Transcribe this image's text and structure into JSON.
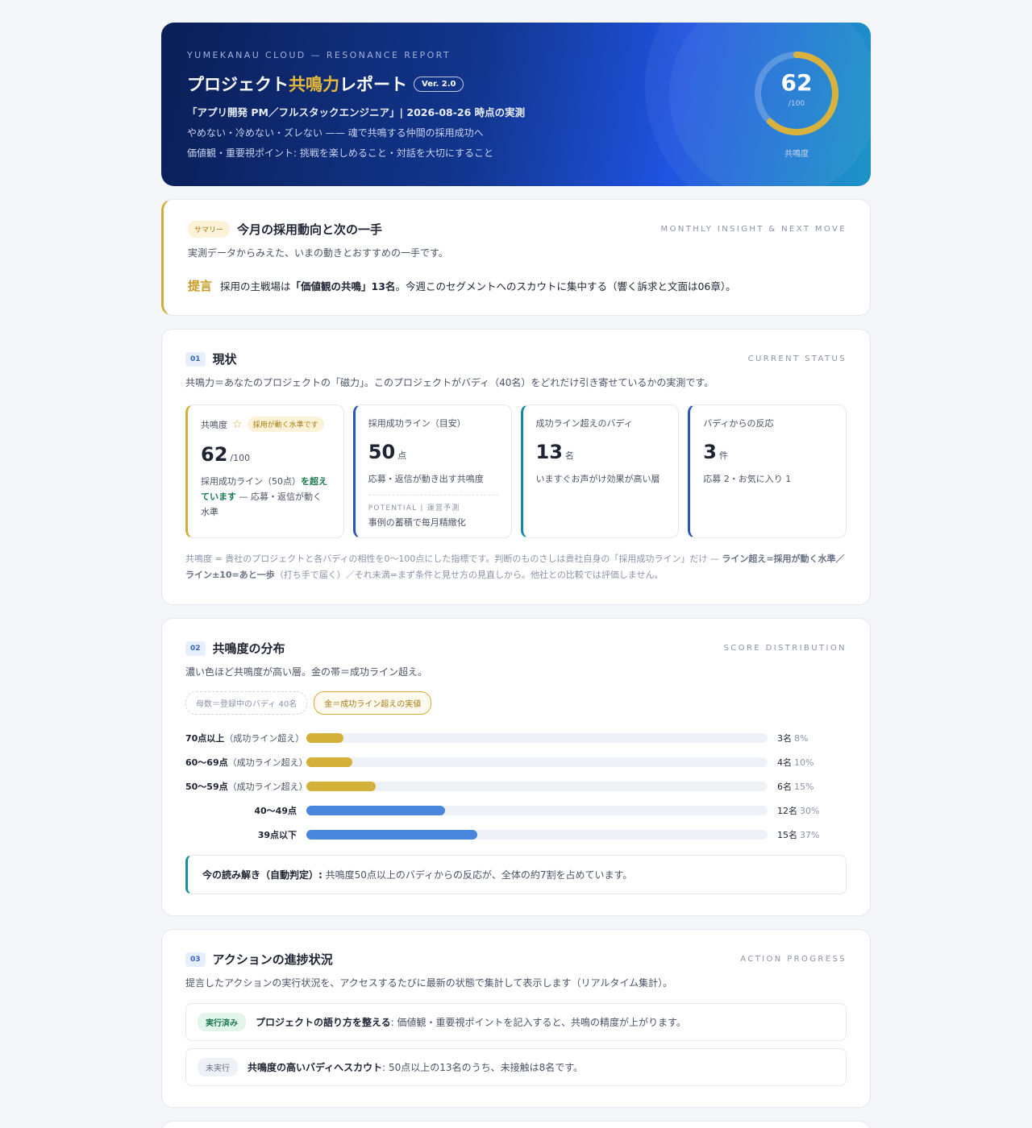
{
  "hero": {
    "eyebrow": "YUMEKANAU CLOUD — RESONANCE REPORT",
    "title_pre": "プロジェクト",
    "title_accent": "共鳴力",
    "title_post": "レポート",
    "version": "Ver. 2.0",
    "subtitle": "「アプリ開発 PM／フルスタックエンジニア」| 2026-08-26 時点の実測",
    "line1": "やめない・冷めない・ズレない —— 魂で共鳴する仲間の採用成功へ",
    "line2": "価値観・重要視ポイント: 挑戦を楽しめること・対話を大切にすること",
    "score": "62",
    "score_max": "/100",
    "score_fraction": 0.62,
    "score_label": "共鳴度"
  },
  "summary": {
    "pill": "サマリー",
    "title": "今月の採用動向と次の一手",
    "en": "MONTHLY INSIGHT & NEXT MOVE",
    "desc": "実測データからみえた、いまの動きとおすすめの一手です。",
    "teigen_label": "提言",
    "teigen_pre": "採用の主戦場は",
    "teigen_bold": "「価値観の共鳴」13名",
    "teigen_post": "。今週このセグメントへのスカウトに集中する（響く訴求と文面は06章）。"
  },
  "status": {
    "num": "01",
    "title": "現状",
    "en": "CURRENT STATUS",
    "desc": "共鳴力＝あなたのプロジェクトの「磁力」。このプロジェクトがバディ（40名）をどれだけ引き寄せているかの実測です。",
    "tiles": [
      {
        "label": "共鳴度",
        "tag": "採用が動く水準です",
        "value": "62",
        "unit": "/100",
        "note_pre": "採用成功ライン（50点）",
        "note_green": "を超えています",
        "note_post": " — 応募・返信が動く水準"
      },
      {
        "label": "採用成功ライン（目安）",
        "value": "50",
        "unit": "点",
        "note": "応募・返信が動き出す共鳴度",
        "potential": "POTENTIAL | 運営予測",
        "potential_note": "事例の蓄積で毎月精緻化"
      },
      {
        "label": "成功ライン超えのバディ",
        "value": "13",
        "unit": "名",
        "note": "いますぐお声がけ効果が高い層"
      },
      {
        "label": "バディからの反応",
        "value": "3",
        "unit": "件",
        "note": "応募 2・お気に入り 1"
      }
    ],
    "footnote_pre": "共鳴度 = 貴社のプロジェクトと各バディの相性を0〜100点にした指標です。判断のものさしは貴社自身の「採用成功ライン」だけ — ",
    "footnote_bold": "ライン超え=採用が動く水準／ライン±10=あと一歩",
    "footnote_post": "（打ち手で届く）／それ未満=まず条件と見せ方の見直しから。他社との比較では評価しません。"
  },
  "distribution": {
    "num": "02",
    "title": "共鳴度の分布",
    "en": "SCORE DISTRIBUTION",
    "desc": "濃い色ほど共鳴度が高い層。金の帯＝成功ライン超え。",
    "chip_grey": "母数＝登録中のバディ 40名",
    "chip_gold": "金＝成功ライン超えの実値",
    "color_gold": "#d4b03a",
    "color_blue": "#4a86db",
    "rows": [
      {
        "label": "70点以上",
        "suffix": "（成功ライン超え）",
        "count": "3名",
        "pct": "8%",
        "value": 8,
        "gold": true
      },
      {
        "label": "60〜69点",
        "suffix": "（成功ライン超え）",
        "count": "4名",
        "pct": "10%",
        "value": 10,
        "gold": true
      },
      {
        "label": "50〜59点",
        "suffix": "（成功ライン超え）",
        "count": "6名",
        "pct": "15%",
        "value": 15,
        "gold": true
      },
      {
        "label": "40〜49点",
        "suffix": "",
        "count": "12名",
        "pct": "30%",
        "value": 30,
        "gold": false
      },
      {
        "label": "39点以下",
        "suffix": "",
        "count": "15名",
        "pct": "37%",
        "value": 37,
        "gold": false
      }
    ],
    "insight_bold": "今の読み解き（自動判定）:",
    "insight_text": " 共鳴度50点以上のバディからの反応が、全体の約7割を占めています。"
  },
  "actions": {
    "num": "03",
    "title": "アクションの進捗状況",
    "en": "ACTION PROGRESS",
    "desc": "提言したアクションの実行状況を、アクセスするたびに最新の状態で集計して表示します（リアルタイム集計）。",
    "items": [
      {
        "status": "実行済み",
        "done": true,
        "bold": "プロジェクトの語り方を整える",
        "text": ": 価値観・重要視ポイントを記入すると、共鳴の精度が上がります。"
      },
      {
        "status": "未実行",
        "done": false,
        "bold": "共鳴度の高いバディへスカウト",
        "text": ": 50点以上の13名のうち、未接触は8名です。"
      }
    ]
  }
}
